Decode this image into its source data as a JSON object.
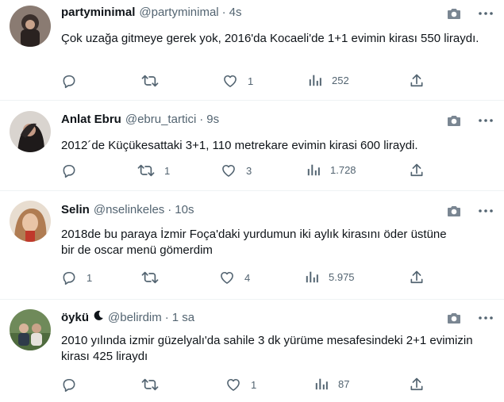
{
  "tweets": [
    {
      "name": "partyminimal",
      "handle": "@partyminimal",
      "separator": "·",
      "time": "4s",
      "text": "Çok uzağa gitmeye gerek yok, 2016'da Kocaeli'de 1+1 evimin kirası 550 liraydı.",
      "replies": "",
      "retweets": "",
      "likes": "1",
      "views": "252",
      "avatar_color": "#3a2f2b"
    },
    {
      "name": "Anlat Ebru",
      "handle": "@ebru_tartici",
      "separator": "·",
      "time": "9s",
      "text": "2012´de Küçükesattaki 3+1, 110 metrekare evimin kirasi 600 liraydi.",
      "replies": "",
      "retweets": "1",
      "likes": "3",
      "views": "1.728",
      "avatar_color": "#2b2626"
    },
    {
      "name": "Selin",
      "handle": "@nselinkeles",
      "separator": "·",
      "time": "10s",
      "text": "2018de bu paraya İzmir Foça'daki yurdumun iki aylık kirasını öder üstüne bir de oscar menü gömerdim",
      "replies": "1",
      "retweets": "",
      "likes": "4",
      "views": "5.975",
      "avatar_color": "#c89a6e"
    },
    {
      "name": "öykü",
      "handle": "@belirdim",
      "separator": "·",
      "time": "1 sa",
      "text": "2010 yılında izmir güzelyalı'da sahile 3 dk yürüme mesafesindeki 2+1 evimizin kirası 425 liraydı",
      "replies": "",
      "retweets": "",
      "likes": "1",
      "views": "87",
      "avatar_color": "#4f6b3e"
    }
  ],
  "icons": {
    "reply": "reply-icon",
    "retweet": "retweet-icon",
    "like": "heart-icon",
    "views": "views-icon",
    "share": "share-icon",
    "camera": "camera-icon",
    "more": "more-icon",
    "moon": "moon-icon"
  },
  "colors": {
    "text": "#0f1419",
    "secondary": "#536471",
    "divider": "#eff3f4"
  }
}
